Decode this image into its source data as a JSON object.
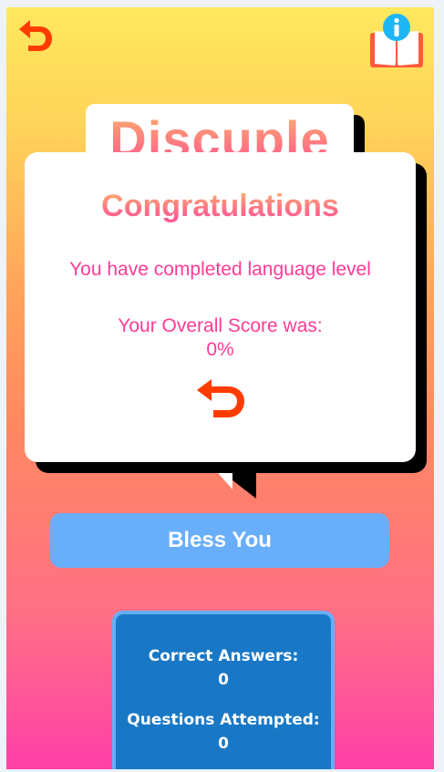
{
  "app": {
    "title": "Discuple",
    "colors": {
      "accent_orange": "#ff3c00",
      "text_pink": "#ff3b96",
      "button_blue": "#69aefb",
      "stats_blue": "#1878c6"
    },
    "icons": {
      "back": "back-arrow-icon",
      "book": "book-icon",
      "info": "info-icon"
    }
  },
  "dialog": {
    "heading": "Congratulations",
    "message": "You have completed language level",
    "score_label": "Your Overall Score was:",
    "score_value": "0%"
  },
  "action": {
    "label": "Bless You"
  },
  "stats": {
    "correct_label": "Correct Answers:",
    "correct_value": "0",
    "attempted_label": "Questions Attempted:",
    "attempted_value": "0"
  }
}
